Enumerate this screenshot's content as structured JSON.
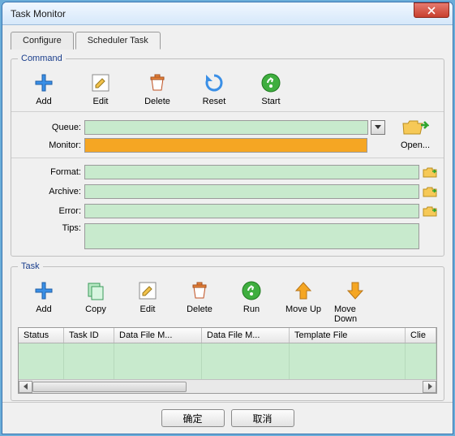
{
  "window": {
    "title": "Task Monitor"
  },
  "tabs": {
    "configure": "Configure",
    "scheduler": "Scheduler Task"
  },
  "command": {
    "legend": "Command",
    "buttons": {
      "add": "Add",
      "edit": "Edit",
      "delete": "Delete",
      "reset": "Reset",
      "start": "Start"
    },
    "queue_label": "Queue:",
    "queue_value": "",
    "monitor_label": "Monitor:",
    "monitor_value": "",
    "open_label": "Open...",
    "format_label": "Format:",
    "format_value": "",
    "archive_label": "Archive:",
    "archive_value": "",
    "error_label": "Error:",
    "error_value": "",
    "tips_label": "Tips:",
    "tips_value": ""
  },
  "task": {
    "legend": "Task",
    "buttons": {
      "add": "Add",
      "copy": "Copy",
      "edit": "Edit",
      "delete": "Delete",
      "run": "Run",
      "moveup": "Move Up",
      "movedown": "Move Down"
    },
    "columns": [
      "Status",
      "Task ID",
      "Data File M...",
      "Data File M...",
      "Template File",
      "Clie"
    ],
    "rows": []
  },
  "footer": {
    "ok": "确定",
    "cancel": "取消"
  }
}
